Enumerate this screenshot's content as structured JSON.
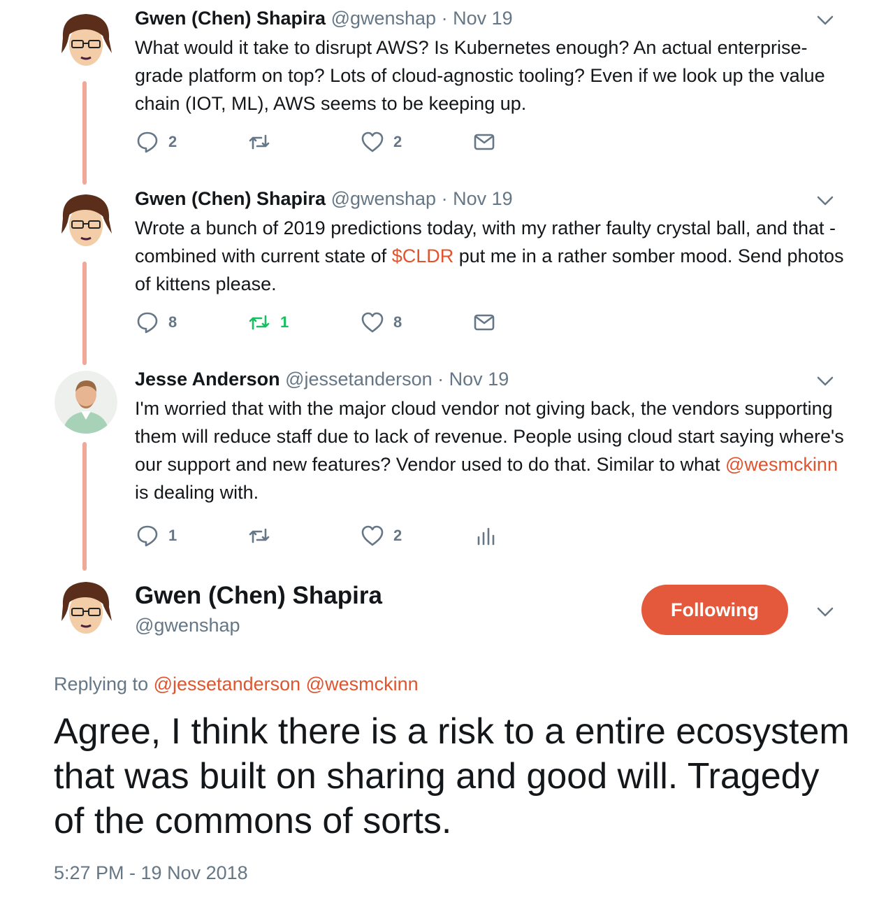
{
  "accent_color": "#e4583b",
  "thread_line_color": "#f0a899",
  "tweets": [
    {
      "name": "Gwen (Chen) Shapira",
      "handle": "@gwenshap",
      "separator": "·",
      "date": "Nov 19",
      "text_parts": [
        "What would it take to disrupt AWS? Is Kubernetes enough? An actual enterprise-grade platform on top? Lots of cloud-agnostic tooling? Even if we look up the value chain (IOT, ML), AWS seems to be keeping up."
      ],
      "reply_count": "2",
      "retweet_count": "",
      "like_count": "2",
      "last_action_icon": "mail-icon"
    },
    {
      "name": "Gwen (Chen) Shapira",
      "handle": "@gwenshap",
      "separator": "·",
      "date": "Nov 19",
      "text_before": "Wrote a bunch of 2019 predictions today, with my rather faulty crystal ball, and that - combined with current state of ",
      "cashtag": "$CLDR",
      "text_after": " put me in a rather somber mood. Send photos of kittens please.",
      "reply_count": "8",
      "retweet_count": "1",
      "like_count": "8",
      "last_action_icon": "mail-icon"
    },
    {
      "name": "Jesse Anderson",
      "handle": "@jessetanderson",
      "separator": "·",
      "date": "Nov 19",
      "text_before": "I'm worried that with the major cloud vendor not giving back, the vendors supporting them will reduce staff due to lack of revenue. People using cloud start saying where's our support and new features? Vendor used to do that. Similar to what ",
      "mention": "@wesmckinn",
      "text_after": " is dealing with.",
      "reply_count": "1",
      "retweet_count": "",
      "like_count": "2",
      "last_action_icon": "analytics-icon"
    }
  ],
  "main": {
    "name": "Gwen (Chen) Shapira",
    "handle": "@gwenshap",
    "follow_label": "Following",
    "replying_label": "Replying to",
    "reply_mention_1": "@jessetanderson",
    "reply_mention_2": "@wesmckinn",
    "text": "Agree, I think there is a risk to a entire ecosystem that was built on sharing and good will. Tragedy of the commons of sorts.",
    "timestamp": "5:27 PM - 19 Nov 2018"
  }
}
